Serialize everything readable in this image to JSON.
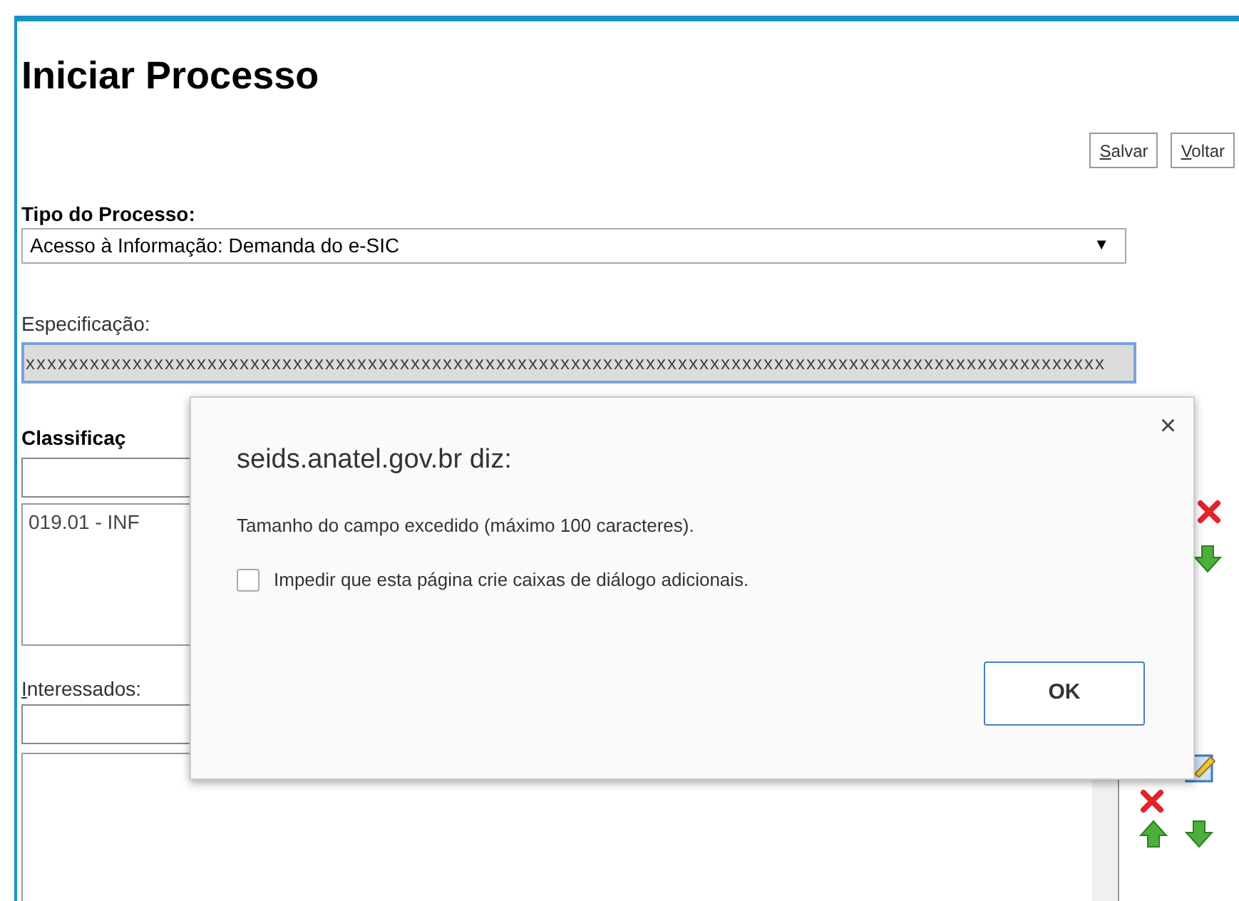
{
  "page": {
    "title": "Iniciar Processo",
    "buttons": [
      {
        "label": "Salvar"
      },
      {
        "label": "Voltar"
      }
    ]
  },
  "tipo_do_processo": {
    "label": "Tipo do Processo:",
    "value": "Acesso à Informação: Demanda do e-SIC",
    "arrow": "▼"
  },
  "especificacao": {
    "label": "Especificação:",
    "value": "xxxxxxxxxxxxxxxxxxxxxxxxxxxxxxxxxxxxxxxxxxxxxxxxxxxxxxxxxxxxxxxxxxxxxxxxxxxxxxxxxxxxxxxxxxxxxxxxxxxxx"
  },
  "classificacao": {
    "label": "Classificaç",
    "items": [
      "019.01 - INF"
    ]
  },
  "interessados": {
    "label": "Interessados:"
  },
  "dialog": {
    "title": "seids.anatel.gov.br diz:",
    "close": "×",
    "message": "Tamanho do campo excedido (máximo 100 caracteres).",
    "checkbox": {
      "label": "Impedir que esta página crie caixas de diálogo adicionais.",
      "checked": false
    },
    "button": "OK"
  }
}
